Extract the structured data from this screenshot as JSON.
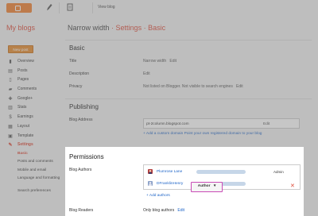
{
  "topbar": {
    "view_blog": "View blog"
  },
  "sidebar": {
    "title": "My blogs",
    "new_post": "New post",
    "items": [
      {
        "label": "Overview",
        "icon": "overview-icon",
        "glyph": "▮"
      },
      {
        "label": "Posts",
        "icon": "posts-icon",
        "glyph": "▤"
      },
      {
        "label": "Pages",
        "icon": "pages-icon",
        "glyph": "▯"
      },
      {
        "label": "Comments",
        "icon": "comments-icon",
        "glyph": "▰"
      },
      {
        "label": "Google+",
        "icon": "google-plus-icon",
        "glyph": "✚"
      },
      {
        "label": "Stats",
        "icon": "stats-icon",
        "glyph": "▥"
      },
      {
        "label": "Earnings",
        "icon": "earnings-icon",
        "glyph": "$"
      },
      {
        "label": "Layout",
        "icon": "layout-icon",
        "glyph": "▦"
      },
      {
        "label": "Template",
        "icon": "template-icon",
        "glyph": "▣"
      },
      {
        "label": "Settings",
        "icon": "wrench-icon",
        "glyph": "✎"
      }
    ],
    "sub_items": [
      "Basic",
      "Posts and comments",
      "Mobile and email",
      "Language and formatting",
      "Search preferences"
    ]
  },
  "breadcrumb": {
    "blog": "Narrow width",
    "sep": "·",
    "section": "Settings",
    "page": "Basic"
  },
  "basic": {
    "title": "Basic",
    "title_label": "Title",
    "title_value": "Narrow width",
    "edit": "Edit",
    "description_label": "Description",
    "privacy_label": "Privacy",
    "privacy_value": "Not listed on Blogger. Not visible to search engines"
  },
  "publishing": {
    "title": "Publishing",
    "address_label": "Blog Address",
    "address_value": "pt-2column.blogspot.com",
    "add_custom": "+ Add a custom domain Point your own registered domain to your blog"
  },
  "permissions": {
    "title": "Permissions",
    "authors_label": "Blog Authors",
    "authors": [
      {
        "name": "Plumrose Lane",
        "role": "Admin"
      },
      {
        "name": "DFranklinHenry",
        "role": "Author"
      }
    ],
    "role_button": "Author",
    "dropdown_caret": "▾",
    "remove": "✕",
    "add_authors": "+ Add authors",
    "readers_label": "Blog Readers",
    "readers_value": "Only blog authors"
  },
  "colors": {
    "accent": "#dd4b39",
    "brand": "#f07f2d",
    "link": "#1c63c7",
    "highlight_border": "#c94bb6"
  }
}
